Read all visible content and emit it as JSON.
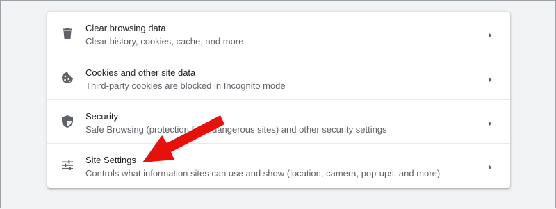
{
  "settings": {
    "rows": [
      {
        "icon": "trash-icon",
        "title": "Clear browsing data",
        "subtitle": "Clear history, cookies, cache, and more"
      },
      {
        "icon": "cookie-icon",
        "title": "Cookies and other site data",
        "subtitle": "Third-party cookies are blocked in Incognito mode"
      },
      {
        "icon": "shield-icon",
        "title": "Security",
        "subtitle": "Safe Browsing (protection from dangerous sites) and other security settings"
      },
      {
        "icon": "tune-icon",
        "title": "Site Settings",
        "subtitle": "Controls what information sites can use and show (location, camera, pop-ups, and more)"
      }
    ]
  },
  "colors": {
    "background": "#f1f3f4",
    "card": "#ffffff",
    "title_text": "#202124",
    "subtitle_text": "#5f6368",
    "icon": "#5f6368",
    "annotation_arrow": "#e8100a"
  }
}
